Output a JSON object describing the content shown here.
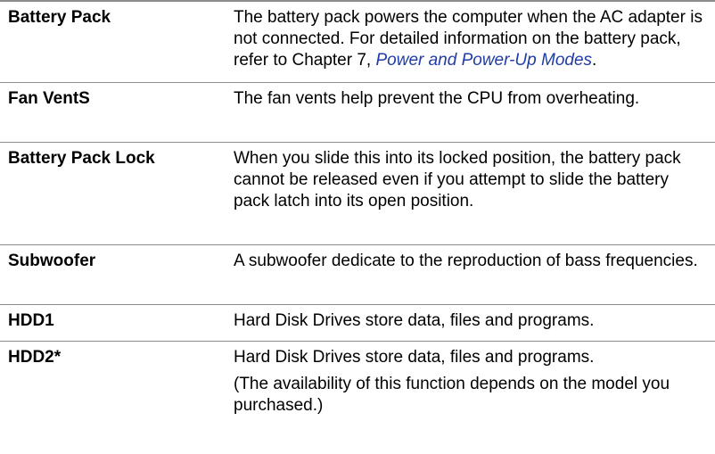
{
  "rows": [
    {
      "term": "Battery Pack",
      "desc_pre": "The battery pack powers the computer when the AC adapter is not connected. For detailed information on the battery pack, refer to Chapter 7,",
      "desc_link": "Power and Power-Up Modes",
      "desc_post": "."
    },
    {
      "term": "Fan VentS",
      "desc": "The fan vents help prevent the CPU from overheating."
    },
    {
      "term": "Battery Pack Lock",
      "desc": "When you slide this into its locked position, the battery pack cannot be released even if you attempt to slide the battery pack latch into its open position."
    },
    {
      "term": "Subwoofer",
      "desc": "A subwoofer dedicate to the reproduction of bass frequencies."
    },
    {
      "term": "HDD1",
      "desc": "Hard Disk Drives store data, files and programs."
    },
    {
      "term": "HDD2*",
      "desc": "Hard Disk Drives store data, files and programs.",
      "note": "(The availability of this function depends on the model you purchased.)"
    }
  ],
  "colors": {
    "rule": "#8c8c8c",
    "link": "#1f3ca8"
  }
}
